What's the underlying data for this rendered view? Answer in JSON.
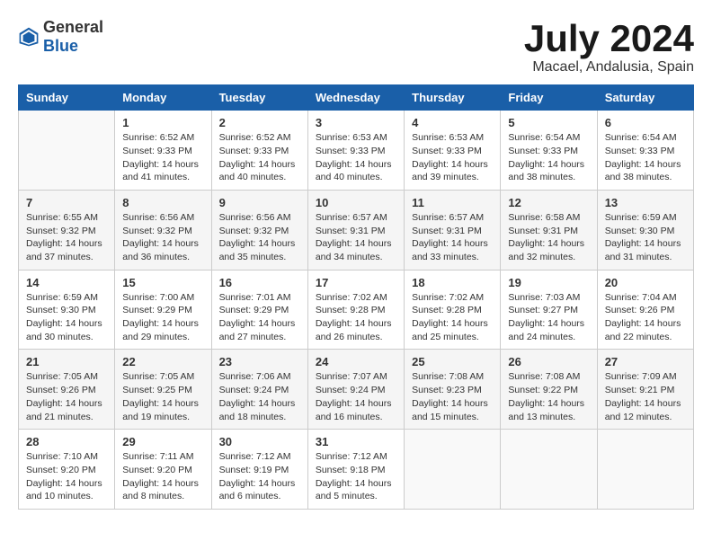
{
  "logo": {
    "general": "General",
    "blue": "Blue"
  },
  "title": {
    "month_year": "July 2024",
    "location": "Macael, Andalusia, Spain"
  },
  "headers": [
    "Sunday",
    "Monday",
    "Tuesday",
    "Wednesday",
    "Thursday",
    "Friday",
    "Saturday"
  ],
  "weeks": [
    [
      {
        "day": "",
        "info": ""
      },
      {
        "day": "1",
        "info": "Sunrise: 6:52 AM\nSunset: 9:33 PM\nDaylight: 14 hours\nand 41 minutes."
      },
      {
        "day": "2",
        "info": "Sunrise: 6:52 AM\nSunset: 9:33 PM\nDaylight: 14 hours\nand 40 minutes."
      },
      {
        "day": "3",
        "info": "Sunrise: 6:53 AM\nSunset: 9:33 PM\nDaylight: 14 hours\nand 40 minutes."
      },
      {
        "day": "4",
        "info": "Sunrise: 6:53 AM\nSunset: 9:33 PM\nDaylight: 14 hours\nand 39 minutes."
      },
      {
        "day": "5",
        "info": "Sunrise: 6:54 AM\nSunset: 9:33 PM\nDaylight: 14 hours\nand 38 minutes."
      },
      {
        "day": "6",
        "info": "Sunrise: 6:54 AM\nSunset: 9:33 PM\nDaylight: 14 hours\nand 38 minutes."
      }
    ],
    [
      {
        "day": "7",
        "info": "Sunrise: 6:55 AM\nSunset: 9:32 PM\nDaylight: 14 hours\nand 37 minutes."
      },
      {
        "day": "8",
        "info": "Sunrise: 6:56 AM\nSunset: 9:32 PM\nDaylight: 14 hours\nand 36 minutes."
      },
      {
        "day": "9",
        "info": "Sunrise: 6:56 AM\nSunset: 9:32 PM\nDaylight: 14 hours\nand 35 minutes."
      },
      {
        "day": "10",
        "info": "Sunrise: 6:57 AM\nSunset: 9:31 PM\nDaylight: 14 hours\nand 34 minutes."
      },
      {
        "day": "11",
        "info": "Sunrise: 6:57 AM\nSunset: 9:31 PM\nDaylight: 14 hours\nand 33 minutes."
      },
      {
        "day": "12",
        "info": "Sunrise: 6:58 AM\nSunset: 9:31 PM\nDaylight: 14 hours\nand 32 minutes."
      },
      {
        "day": "13",
        "info": "Sunrise: 6:59 AM\nSunset: 9:30 PM\nDaylight: 14 hours\nand 31 minutes."
      }
    ],
    [
      {
        "day": "14",
        "info": "Sunrise: 6:59 AM\nSunset: 9:30 PM\nDaylight: 14 hours\nand 30 minutes."
      },
      {
        "day": "15",
        "info": "Sunrise: 7:00 AM\nSunset: 9:29 PM\nDaylight: 14 hours\nand 29 minutes."
      },
      {
        "day": "16",
        "info": "Sunrise: 7:01 AM\nSunset: 9:29 PM\nDaylight: 14 hours\nand 27 minutes."
      },
      {
        "day": "17",
        "info": "Sunrise: 7:02 AM\nSunset: 9:28 PM\nDaylight: 14 hours\nand 26 minutes."
      },
      {
        "day": "18",
        "info": "Sunrise: 7:02 AM\nSunset: 9:28 PM\nDaylight: 14 hours\nand 25 minutes."
      },
      {
        "day": "19",
        "info": "Sunrise: 7:03 AM\nSunset: 9:27 PM\nDaylight: 14 hours\nand 24 minutes."
      },
      {
        "day": "20",
        "info": "Sunrise: 7:04 AM\nSunset: 9:26 PM\nDaylight: 14 hours\nand 22 minutes."
      }
    ],
    [
      {
        "day": "21",
        "info": "Sunrise: 7:05 AM\nSunset: 9:26 PM\nDaylight: 14 hours\nand 21 minutes."
      },
      {
        "day": "22",
        "info": "Sunrise: 7:05 AM\nSunset: 9:25 PM\nDaylight: 14 hours\nand 19 minutes."
      },
      {
        "day": "23",
        "info": "Sunrise: 7:06 AM\nSunset: 9:24 PM\nDaylight: 14 hours\nand 18 minutes."
      },
      {
        "day": "24",
        "info": "Sunrise: 7:07 AM\nSunset: 9:24 PM\nDaylight: 14 hours\nand 16 minutes."
      },
      {
        "day": "25",
        "info": "Sunrise: 7:08 AM\nSunset: 9:23 PM\nDaylight: 14 hours\nand 15 minutes."
      },
      {
        "day": "26",
        "info": "Sunrise: 7:08 AM\nSunset: 9:22 PM\nDaylight: 14 hours\nand 13 minutes."
      },
      {
        "day": "27",
        "info": "Sunrise: 7:09 AM\nSunset: 9:21 PM\nDaylight: 14 hours\nand 12 minutes."
      }
    ],
    [
      {
        "day": "28",
        "info": "Sunrise: 7:10 AM\nSunset: 9:20 PM\nDaylight: 14 hours\nand 10 minutes."
      },
      {
        "day": "29",
        "info": "Sunrise: 7:11 AM\nSunset: 9:20 PM\nDaylight: 14 hours\nand 8 minutes."
      },
      {
        "day": "30",
        "info": "Sunrise: 7:12 AM\nSunset: 9:19 PM\nDaylight: 14 hours\nand 6 minutes."
      },
      {
        "day": "31",
        "info": "Sunrise: 7:12 AM\nSunset: 9:18 PM\nDaylight: 14 hours\nand 5 minutes."
      },
      {
        "day": "",
        "info": ""
      },
      {
        "day": "",
        "info": ""
      },
      {
        "day": "",
        "info": ""
      }
    ]
  ]
}
